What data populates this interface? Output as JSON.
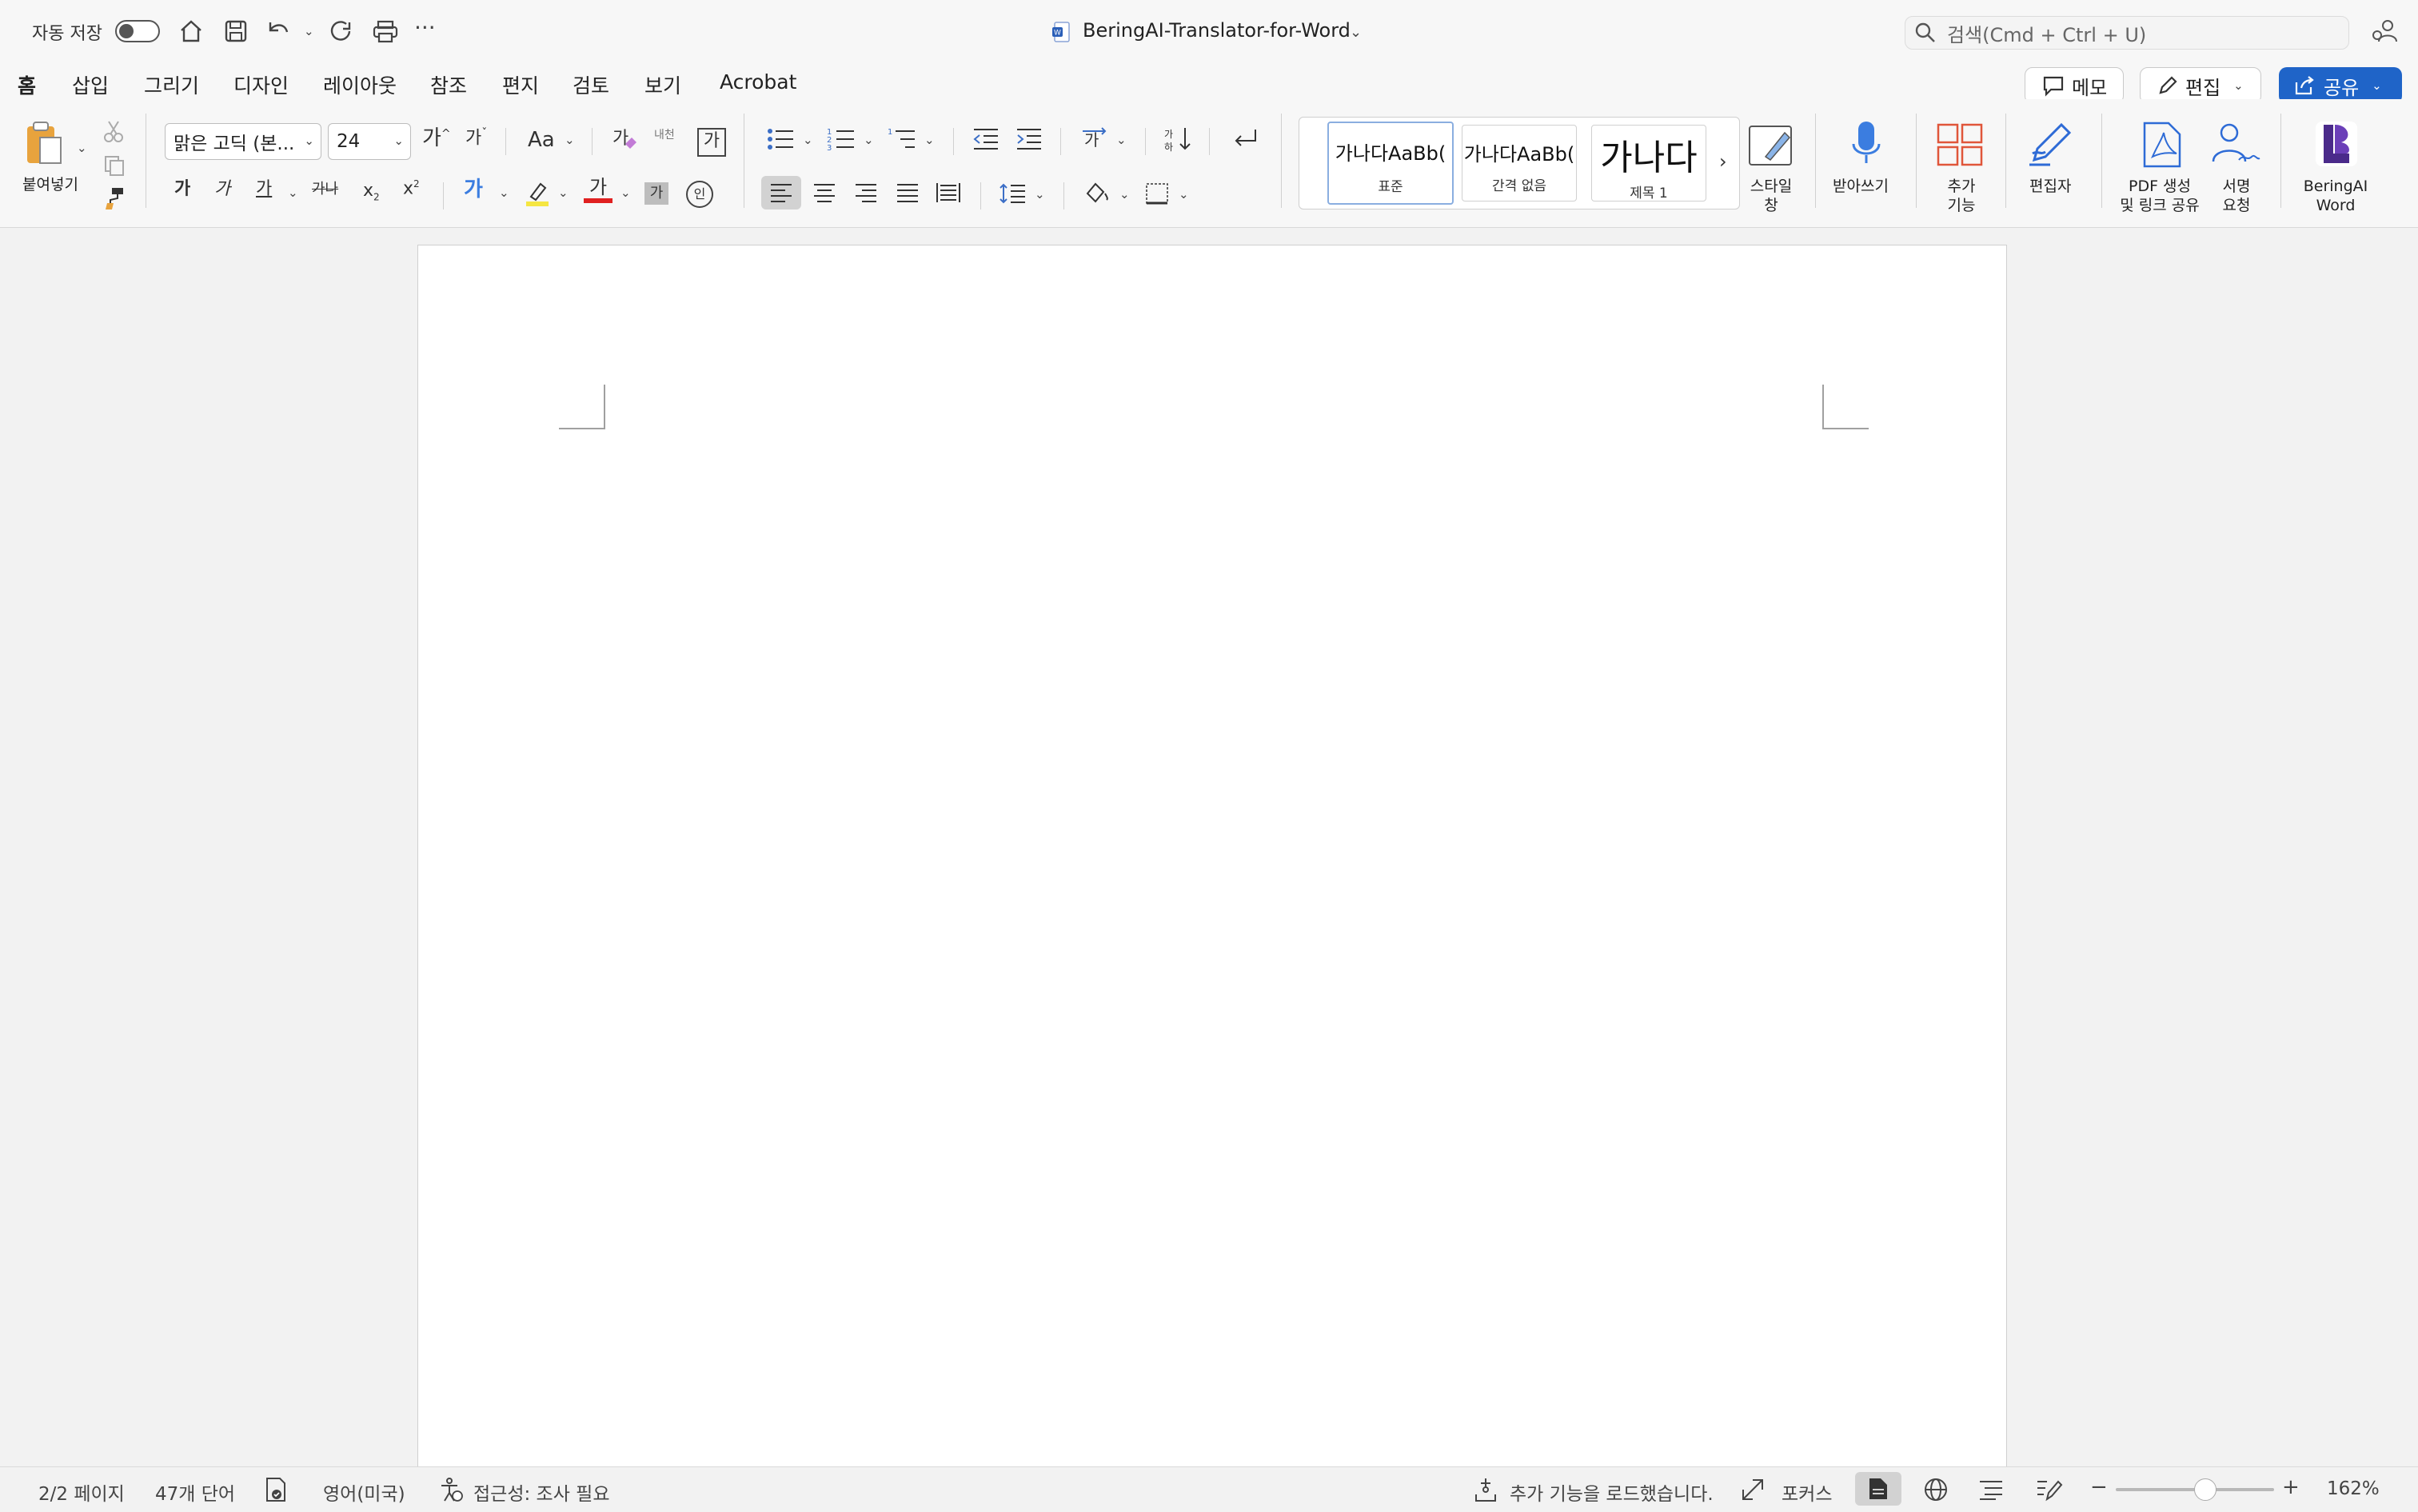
{
  "titlebar": {
    "autosave_label": "자동 저장",
    "doc_title": "BeringAI-Translator-for-Word",
    "search_placeholder": "검색(Cmd + Ctrl + U)"
  },
  "tabs": [
    "홈",
    "삽입",
    "그리기",
    "디자인",
    "레이아웃",
    "참조",
    "편지",
    "검토",
    "보기",
    "Acrobat"
  ],
  "tab_actions": {
    "memo_label": "메모",
    "edit_label": "편집",
    "share_label": "공유"
  },
  "ribbon": {
    "paste_label": "붙여넣기",
    "font_name": "맑은 고딕 (본...",
    "font_size": "24",
    "grow_font": "가",
    "shrink_font": "가",
    "change_case": "Aa",
    "phonetic": "내천",
    "char_border": "가",
    "bold": "가",
    "italic": "가",
    "underline": "가",
    "strike": "가나",
    "subscript": "x",
    "superscript": "x",
    "text_effect": "가",
    "font_color": "가",
    "char_shading": "가",
    "enclosed": "인",
    "styles": [
      {
        "sample": "가나다AaBb(",
        "name": "표준"
      },
      {
        "sample": "가나다AaBb(",
        "name": "간격 없음"
      },
      {
        "sample": "가나다",
        "name": "제목 1"
      }
    ],
    "styles_pane_label": "스타일\n창",
    "dictate_label": "받아쓰기",
    "addins_label": "추가\n기능",
    "editor_label": "편집자",
    "pdf_label": "PDF 생성\n및 링크 공유",
    "sign_label": "서명\n요청",
    "beringai_label": "BeringAI\nWord"
  },
  "statusbar": {
    "page": "2/2 페이지",
    "words": "47개 단어",
    "language": "영어(미국)",
    "accessibility": "접근성: 조사 필요",
    "addins_loaded": "추가 기능을 로드했습니다.",
    "focus": "포커스",
    "zoom": "162%"
  },
  "colors": {
    "accent": "#1f64c8",
    "highlight": "#f5e642",
    "font_color_bar": "#e02020",
    "beringai": "#4a2a8a"
  }
}
